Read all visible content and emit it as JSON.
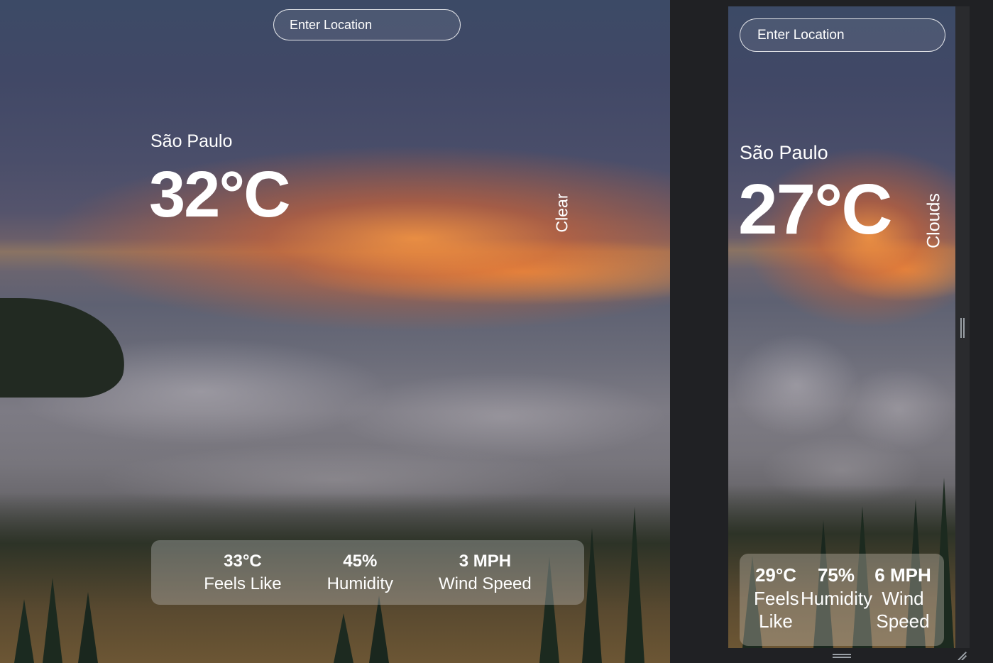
{
  "large_view": {
    "search": {
      "placeholder": "Enter Location"
    },
    "city": "São Paulo",
    "temperature": "32°C",
    "condition": "Clear",
    "stats": [
      {
        "value": "33°C",
        "label": "Feels Like"
      },
      {
        "value": "45%",
        "label": "Humidity"
      },
      {
        "value": "3 MPH",
        "label": "Wind Speed"
      }
    ]
  },
  "small_view": {
    "search": {
      "placeholder": "Enter Location"
    },
    "city": "São Paulo",
    "temperature": "27°C",
    "condition": "Clouds",
    "stats": [
      {
        "value": "29°C",
        "label": "Feels Like"
      },
      {
        "value": "75%",
        "label": "Humidity"
      },
      {
        "value": "6 MPH",
        "label": "Wind Speed"
      }
    ]
  },
  "icons": {
    "vertical_resize": "vertical-resize-handle-icon",
    "horizontal_resize": "horizontal-resize-handle-icon",
    "corner_resize": "corner-resize-grip-icon"
  }
}
